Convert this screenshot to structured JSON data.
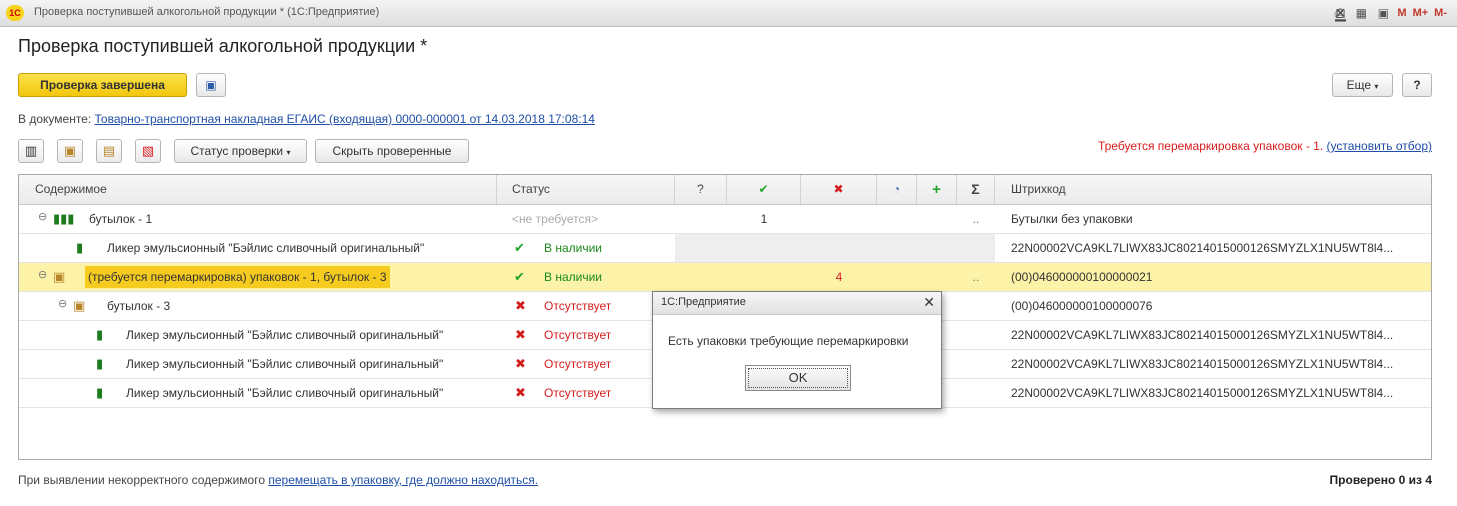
{
  "window": {
    "title": "Проверка поступившей алкогольной продукции * (1С:Предприятие)",
    "logo": "1С"
  },
  "page": {
    "title": "Проверка поступившей алкогольной продукции *",
    "done_button": "Проверка завершена",
    "more_button": "Еще",
    "help_button": "?"
  },
  "document": {
    "label": "В документе:",
    "link": "Товарно-транспортная накладная ЕГАИС (входящая) 0000-000001 от 14.03.2018 17:08:14"
  },
  "toolbar": {
    "status_button": "Статус проверки",
    "hide_checked_button": "Скрыть проверенные",
    "icons": [
      "barcode-scan-icon",
      "add-package-icon",
      "package-barcode-icon",
      "print-barcode-icon"
    ]
  },
  "warning": {
    "text": "Требуется перемаркировка упаковок - 1.",
    "link": "(установить отбор)"
  },
  "columns": {
    "content": "Содержимое",
    "status": "Статус",
    "question": "?",
    "check": "✔",
    "cross": "✖",
    "pie": "◔",
    "plus": "+",
    "sum": "Σ",
    "barcode": "Штрихкод"
  },
  "rows": [
    {
      "toggle": "⊖",
      "content": "бутылок - 1",
      "status": "<не требуется>",
      "check": "1",
      "sum": "..",
      "barcode": "Бутылки без упаковки"
    },
    {
      "content": "Ликер эмульсионный \"Бэйлис сливочный оригинальный\"",
      "status": "В наличии",
      "barcode": "22N00002VCA9KL7LIWX83JC80214015000126SMYZLX1NU5WT8l4..."
    },
    {
      "toggle": "⊖",
      "content": "(требуется перемаркировка) упаковок - 1, бутылок - 3",
      "status": "В наличии",
      "cross": "4",
      "sum": "..",
      "barcode": "(00)046000000100000021"
    },
    {
      "toggle": "⊖",
      "content": "бутылок - 3",
      "status": "Отсутствует",
      "barcode": "(00)046000000100000076"
    },
    {
      "content": "Ликер эмульсионный \"Бэйлис сливочный оригинальный\"",
      "status": "Отсутствует",
      "barcode": "22N00002VCA9KL7LIWX83JC80214015000126SMYZLX1NU5WT8l4..."
    },
    {
      "content": "Ликер эмульсионный \"Бэйлис сливочный оригинальный\"",
      "status": "Отсутствует",
      "barcode": "22N00002VCA9KL7LIWX83JC80214015000126SMYZLX1NU5WT8l4..."
    },
    {
      "content": "Ликер эмульсионный \"Бэйлис сливочный оригинальный\"",
      "status": "Отсутствует",
      "barcode": "22N00002VCA9KL7LIWX83JC80214015000126SMYZLX1NU5WT8l4..."
    }
  ],
  "footer": {
    "text": "При выявлении некорректного содержимого",
    "link": "перемещать в упаковку, где должно находиться.",
    "checked": "Проверено 0 из 4"
  },
  "dialog": {
    "title": "1С:Предприятие",
    "message": "Есть упаковки требующие перемаркировки",
    "ok": "OK"
  },
  "colors": {
    "accent_yellow": "#f2c60d",
    "selected_row": "#fdf3a8",
    "error_red": "#d61d1d",
    "ok_green": "#22a32a",
    "link_blue": "#1f4ea8"
  }
}
